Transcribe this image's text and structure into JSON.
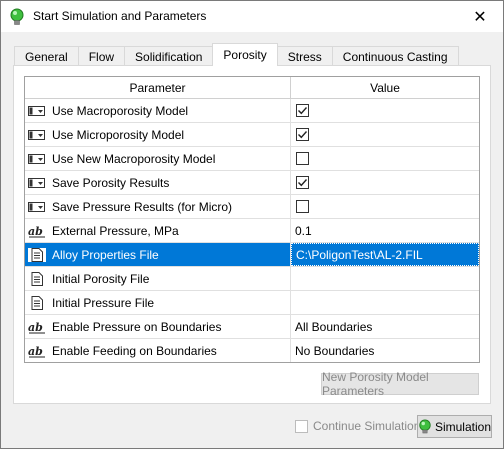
{
  "window": {
    "title": "Start Simulation and Parameters",
    "close_glyph": "✕",
    "icon": "green-bulb-icon"
  },
  "tabs": [
    {
      "label": "General",
      "active": false
    },
    {
      "label": "Flow",
      "active": false
    },
    {
      "label": "Solidification",
      "active": false
    },
    {
      "label": "Porosity",
      "active": true
    },
    {
      "label": "Stress",
      "active": false
    },
    {
      "label": "Continuous Casting",
      "active": false
    }
  ],
  "grid": {
    "headers": {
      "parameter": "Parameter",
      "value": "Value"
    },
    "rows": [
      {
        "icon": "checkbox-param-icon",
        "label": "Use Macroporosity Model",
        "type": "checkbox",
        "checked": true,
        "value": ""
      },
      {
        "icon": "checkbox-param-icon",
        "label": "Use Microporosity Model",
        "type": "checkbox",
        "checked": true,
        "value": ""
      },
      {
        "icon": "checkbox-param-icon",
        "label": "Use New Macroporosity Model",
        "type": "checkbox",
        "checked": false,
        "value": ""
      },
      {
        "icon": "checkbox-param-icon",
        "label": "Save Porosity Results",
        "type": "checkbox",
        "checked": true,
        "value": ""
      },
      {
        "icon": "checkbox-param-icon",
        "label": "Save Pressure Results (for Micro)",
        "type": "checkbox",
        "checked": false,
        "value": ""
      },
      {
        "icon": "abc-param-icon",
        "label": "External Pressure, MPa",
        "type": "text",
        "value": "0.1"
      },
      {
        "icon": "file-param-icon",
        "label": "Alloy Properties File",
        "type": "text",
        "value": "C:\\PoligonTest\\AL-2.FIL",
        "selected": true
      },
      {
        "icon": "file-param-icon",
        "label": "Initial Porosity File",
        "type": "text",
        "value": ""
      },
      {
        "icon": "file-param-icon",
        "label": "Initial Pressure File",
        "type": "text",
        "value": ""
      },
      {
        "icon": "abc-param-icon",
        "label": "Enable Pressure on Boundaries",
        "type": "text",
        "value": "All Boundaries"
      },
      {
        "icon": "abc-param-icon",
        "label": "Enable Feeding on Boundaries",
        "type": "text",
        "value": "No Boundaries"
      }
    ]
  },
  "buttons": {
    "new_porosity": "New Porosity Model Parameters",
    "continue_simulation": "Continue Simulation",
    "simulation": "Simulation"
  },
  "colors": {
    "selection": "#0078d7",
    "accent_green": "#3fbf3f"
  }
}
